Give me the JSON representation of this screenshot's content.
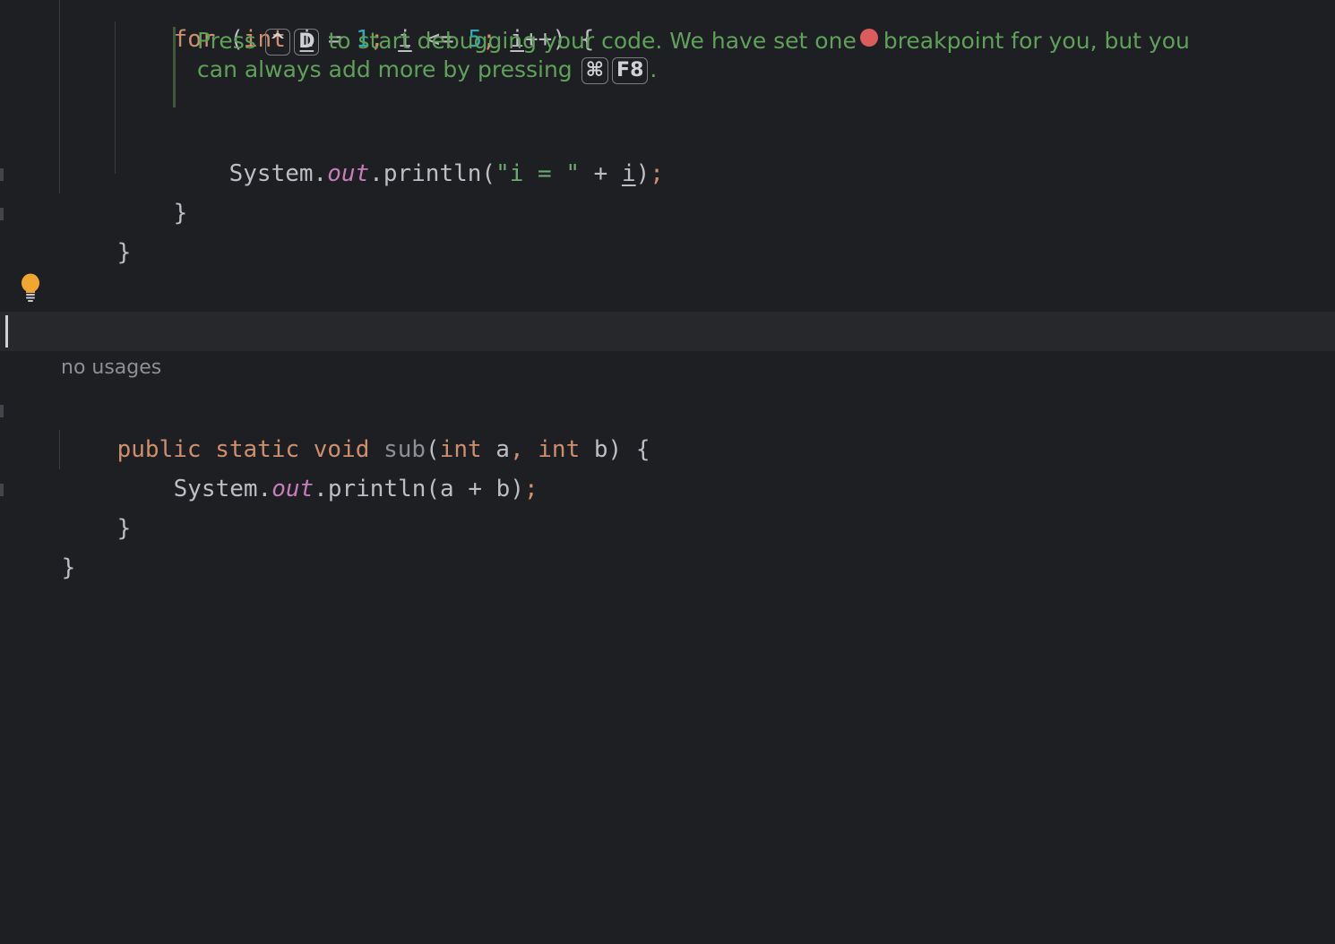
{
  "code": {
    "line_for": {
      "kw_for": "for",
      "paren_open": " (",
      "kw_int": "int",
      "sp1": " ",
      "var_i1": "i",
      "assign": " = ",
      "num1": "1",
      "semi1": ";",
      "sp2": " ",
      "var_i2": "i",
      "lte": " <= ",
      "num5": "5",
      "semi2": ";",
      "sp3": " ",
      "var_i3": "i",
      "incr": "++) {"
    },
    "line_println1": {
      "system": "System.",
      "out": "out",
      "println": ".println(",
      "str": "\"i = \"",
      "plus": " + ",
      "var_i": "i",
      "close": ")",
      "semi": ";"
    },
    "brace_inner": "}",
    "brace_method": "}",
    "sub_usages": "no usages",
    "line_sub_decl": {
      "kw_public": "public",
      "kw_static": "static",
      "kw_void": "void",
      "name": "sub",
      "paren_open": "(",
      "kw_int1": "int",
      "param_a": " a",
      "comma": ",",
      "kw_int2": "int",
      "param_b": " b) {"
    },
    "line_println2": {
      "system": "System.",
      "out": "out",
      "println": ".println(a + b)",
      "semi": ";"
    },
    "brace_sub": "}",
    "brace_class": "}"
  },
  "debug_tip": {
    "press": "Press",
    "key_ctrl": "^",
    "key_d": "D",
    "text1": "to start debugging your code. We have set one",
    "text2": "breakpoint for you, but you",
    "text3": "can always add more by pressing",
    "key_cmd": "⌘",
    "key_f8": "F8",
    "period": "."
  },
  "colors": {
    "background": "#1e1f22",
    "keyword": "#cf8e6d",
    "number": "#2aacb8",
    "string": "#6aab73",
    "field": "#c77dbb",
    "doc_text": "#5fa05a",
    "breakpoint": "#db5c5c",
    "bulb": "#f0a732"
  },
  "icons": {
    "intention_bulb": "lightbulb-icon",
    "breakpoint": "breakpoint-dot-icon"
  }
}
